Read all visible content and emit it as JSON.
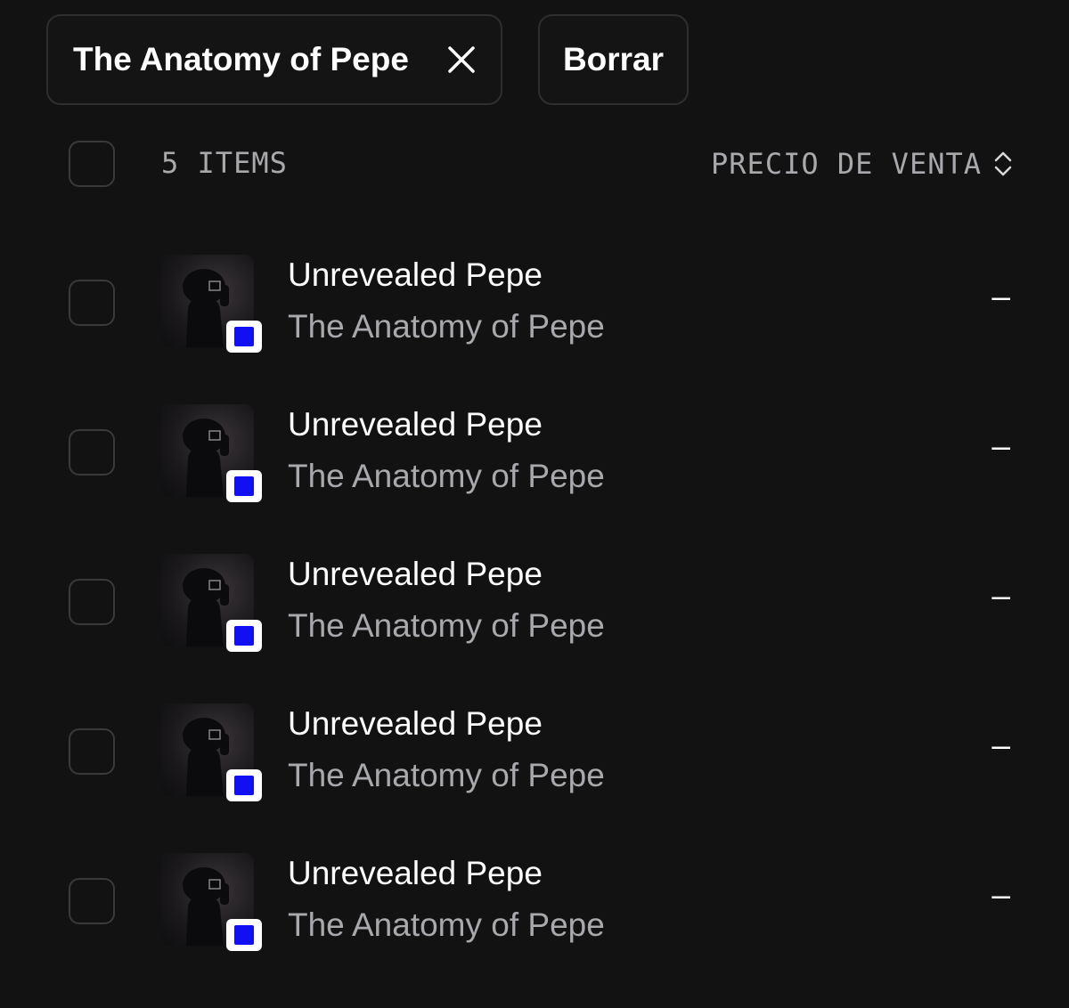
{
  "filters": {
    "active_filter_label": "The Anatomy of Pepe",
    "clear_label": "Borrar"
  },
  "list_header": {
    "items_count": "5 ITEMS",
    "sort_label": "PRECIO DE VENTA"
  },
  "items": [
    {
      "name": "Unrevealed Pepe",
      "collection": "The Anatomy of Pepe",
      "price": "–"
    },
    {
      "name": "Unrevealed Pepe",
      "collection": "The Anatomy of Pepe",
      "price": "–"
    },
    {
      "name": "Unrevealed Pepe",
      "collection": "The Anatomy of Pepe",
      "price": "–"
    },
    {
      "name": "Unrevealed Pepe",
      "collection": "The Anatomy of Pepe",
      "price": "–"
    },
    {
      "name": "Unrevealed Pepe",
      "collection": "The Anatomy of Pepe",
      "price": "–"
    }
  ],
  "colors": {
    "background": "#121213",
    "chain_badge": "#1010f0"
  },
  "icons": {
    "remove_filter": "close-icon",
    "sort": "sort-icon",
    "chain": "chain-badge-icon"
  }
}
